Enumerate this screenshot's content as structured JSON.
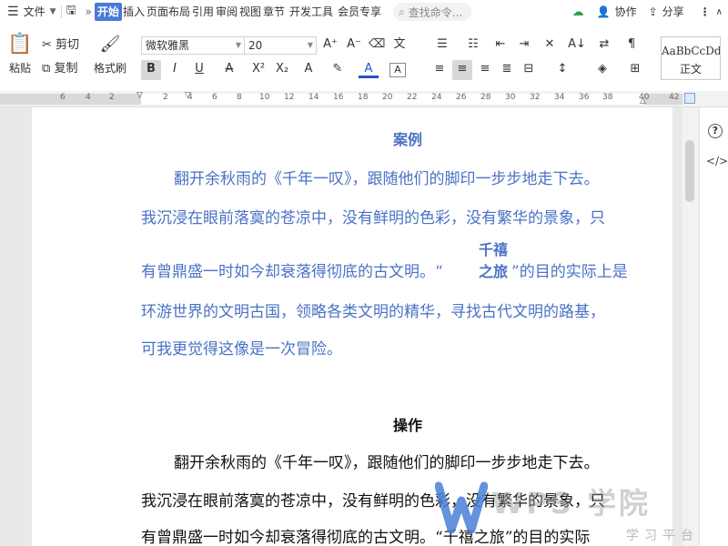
{
  "menu": {
    "file_label": "文件",
    "tabs": [
      "开始",
      "插入",
      "页面布局",
      "引用",
      "审阅",
      "视图",
      "章节",
      "开发工具",
      "会员专享"
    ],
    "search_placeholder": "查找命令...",
    "collab_label": "协作",
    "share_label": "分享"
  },
  "toolbar": {
    "paste_label": "粘贴",
    "cut_label": "剪切",
    "copy_label": "复制",
    "format_painter_label": "格式刷",
    "font_name": "微软雅黑",
    "font_size": "20",
    "style_sample": "AaBbCcDd",
    "style_name": "正文"
  },
  "ruler": {
    "left_numbers": [
      "6",
      "4",
      "2"
    ],
    "numbers": [
      "2",
      "4",
      "6",
      "8",
      "10",
      "12",
      "14",
      "16",
      "18",
      "20",
      "22",
      "24",
      "26",
      "28",
      "30",
      "32",
      "34",
      "36",
      "38",
      "40",
      "42"
    ]
  },
  "doc": {
    "case_title": "案例",
    "case_lines": [
      "翻开余秋雨的《千年一叹》，跟随他们的脚印一步步地走下去。",
      "我沉浸在眼前落寞的苍凉中，没有鲜明的色彩，没有繁华的景象，只",
      "有曾鼎盛一时如今却衰落得彻底的古文明。“",
      "”的目的实际上是",
      "环游世界的文明古国，领略各类文明的精华，寻找古代文明的路基，",
      "可我更觉得这像是一次冒险。"
    ],
    "case_inline_note_1": "千禧",
    "case_inline_note_2": "之旅",
    "op_title": "操作",
    "op_lines": [
      "翻开余秋雨的《千年一叹》，跟随他们的脚印一步步地走下去。",
      "我沉浸在眼前落寞的苍凉中，没有鲜明的色彩，没有繁华的景象，只",
      "有曾鼎盛一时如今却衰落得彻底的古文明。“千禧之旅”的目的实际"
    ]
  },
  "watermark": {
    "brand": "WPS 学院",
    "tagline": "学习平台"
  },
  "colors": {
    "accent": "#4a79d9",
    "case_text": "#4a72c4"
  }
}
